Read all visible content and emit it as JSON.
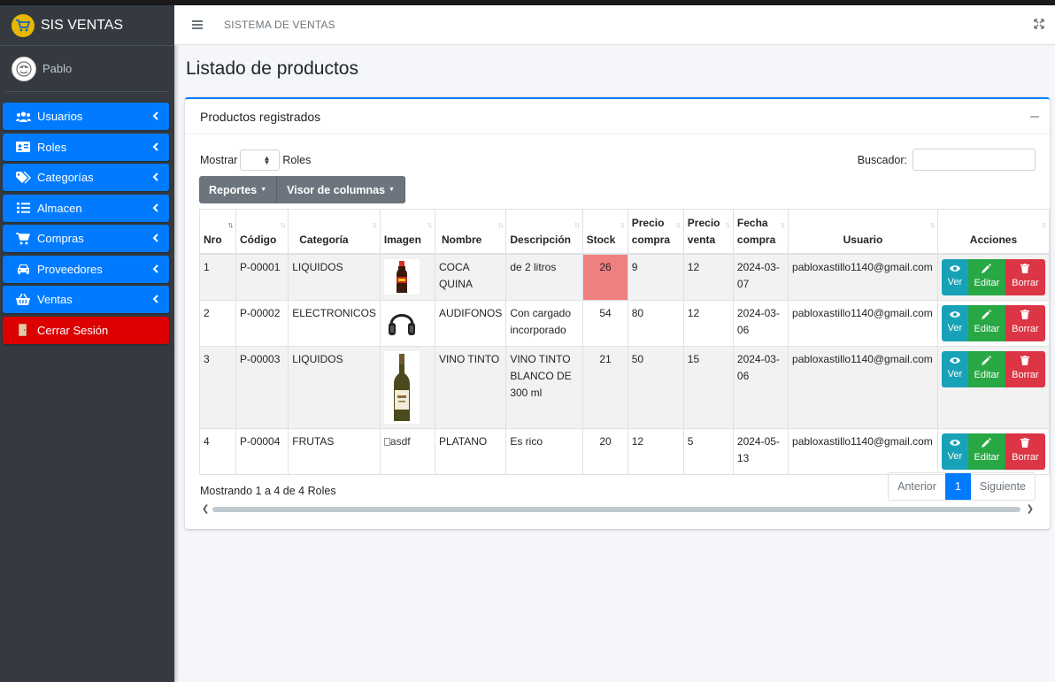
{
  "app": {
    "brand": "SIS VENTAS",
    "user": "Pablo",
    "header_title": "SISTEMA DE VENTAS"
  },
  "sidebar": {
    "items": [
      {
        "label": "Usuarios",
        "icon": "users-icon"
      },
      {
        "label": "Roles",
        "icon": "id-card-icon"
      },
      {
        "label": "Categorías",
        "icon": "tags-icon"
      },
      {
        "label": "Almacen",
        "icon": "list-icon"
      },
      {
        "label": "Compras",
        "icon": "cart-icon"
      },
      {
        "label": "Proveedores",
        "icon": "car-icon"
      },
      {
        "label": "Ventas",
        "icon": "basket-icon"
      }
    ],
    "logout": "Cerrar Sesión"
  },
  "page": {
    "title": "Listado de productos"
  },
  "card": {
    "title": "Productos registrados"
  },
  "controls": {
    "show_label": "Mostrar",
    "show_suffix": "Roles",
    "search_label": "Buscador:",
    "btn_reports": "Reportes",
    "btn_columns": "Visor de columnas"
  },
  "table": {
    "headers": [
      "Nro",
      "Código",
      "Categoría",
      "Imagen",
      "Nombre",
      "Descripción",
      "Stock",
      "Precio compra",
      "Precio venta",
      "Fecha compra",
      "Usuario",
      "Acciones"
    ],
    "rows": [
      {
        "nro": "1",
        "codigo": "P-00001",
        "categoria": "LIQUIDOS",
        "imagen": "bottle-cola",
        "nombre": "COCA QUINA",
        "descripcion": "de 2 litros",
        "stock": "26",
        "precio_compra": "9",
        "precio_venta": "12",
        "fecha": "2024-03-07",
        "usuario": "pabloxastillo1140@gmail.com"
      },
      {
        "nro": "2",
        "codigo": "P-00002",
        "categoria": "ELECTRONICOS",
        "imagen": "headphones",
        "nombre": "AUDIFONOS",
        "descripcion": "Con cargado incorporado",
        "stock": "54",
        "precio_compra": "80",
        "precio_venta": "12",
        "fecha": "2024-03-06",
        "usuario": "pabloxastillo1140@gmail.com"
      },
      {
        "nro": "3",
        "codigo": "P-00003",
        "categoria": "LIQUIDOS",
        "imagen": "wine-bottle",
        "nombre": "VINO TINTO",
        "descripcion": "VINO TINTO BLANCO DE 300 ml",
        "stock": "21",
        "precio_compra": "50",
        "precio_venta": "15",
        "fecha": "2024-03-06",
        "usuario": "pabloxastillo1140@gmail.com"
      },
      {
        "nro": "4",
        "codigo": "P-00004",
        "categoria": "FRUTAS",
        "imagen": "broken",
        "imagen_alt": "asdf",
        "nombre": "PLATANO",
        "descripcion": "Es rico",
        "stock": "20",
        "precio_compra": "12",
        "precio_venta": "5",
        "fecha": "2024-05-13",
        "usuario": "pabloxastillo1140@gmail.com"
      }
    ],
    "actions": {
      "view": "Ver",
      "edit": "Editar",
      "delete": "Borrar"
    }
  },
  "footer": {
    "info": "Mostrando 1 a 4 de 4 Roles",
    "prev": "Anterior",
    "page": "1",
    "next": "Siguiente"
  },
  "colors": {
    "primary": "#007bff",
    "sidebar": "#343a40",
    "danger": "#dc0000",
    "stock_alert": "#f08080",
    "info": "#17a2b8",
    "success": "#28a745",
    "delete": "#dc3545"
  }
}
